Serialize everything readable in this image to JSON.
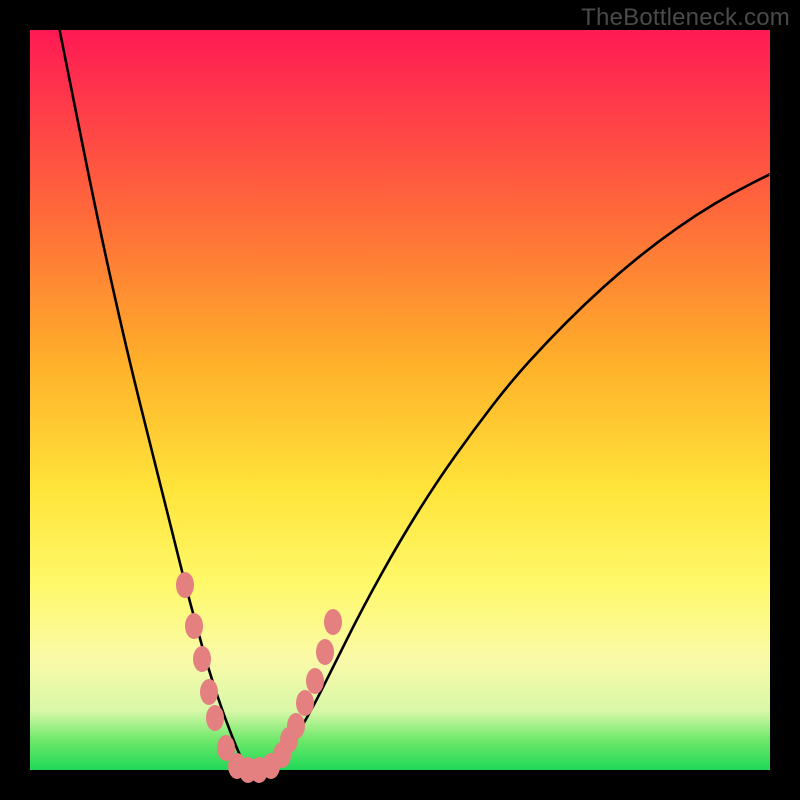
{
  "watermark": "TheBottleneck.com",
  "colors": {
    "black": "#000000",
    "curve": "#000000",
    "marker_fill": "#e48080",
    "gradient_top": "#ff1a54",
    "gradient_bottom": "#20d858"
  },
  "chart_data": {
    "type": "line",
    "title": "",
    "xlabel": "",
    "ylabel": "",
    "xlim": [
      0,
      100
    ],
    "ylim": [
      0,
      100
    ],
    "grid": false,
    "legend": false,
    "annotations": [
      "TheBottleneck.com"
    ],
    "series": [
      {
        "name": "bottleneck-curve",
        "x": [
          4,
          6,
          8,
          10,
          12,
          14,
          16,
          18,
          19.5,
          21,
          22.5,
          24,
          26,
          27.5,
          29,
          31,
          33,
          35,
          38,
          41,
          45,
          50,
          55,
          60,
          65,
          70,
          75,
          80,
          85,
          90,
          95,
          100
        ],
        "y": [
          100,
          90,
          80,
          70.5,
          61.5,
          53,
          45,
          37,
          31,
          25,
          19.5,
          14,
          8,
          4,
          0.5,
          0,
          0.5,
          3,
          8,
          14,
          22,
          31,
          39,
          46,
          52.5,
          58,
          63,
          67.5,
          71.5,
          75,
          78,
          80.5
        ]
      }
    ],
    "markers": {
      "name": "highlighted-region",
      "description": "salmon oval markers clustered around curve minimum",
      "x": [
        21,
        22.2,
        23.3,
        24.2,
        25,
        26.5,
        28,
        29.5,
        31,
        32.5,
        34,
        35,
        36,
        37.2,
        38.5,
        39.8,
        41
      ],
      "y": [
        25,
        19.5,
        15,
        10.5,
        7,
        3,
        0.5,
        0,
        0,
        0.5,
        2,
        4,
        6,
        9,
        12,
        16,
        20
      ]
    }
  }
}
